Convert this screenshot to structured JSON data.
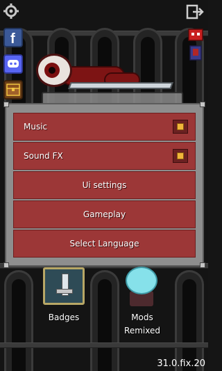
{
  "menu": {
    "items": [
      {
        "label": "Music",
        "type": "toggle",
        "checked": true
      },
      {
        "label": "Sound FX",
        "type": "toggle",
        "checked": true
      },
      {
        "label": "Ui settings",
        "type": "button"
      },
      {
        "label": "Gameplay",
        "type": "button"
      },
      {
        "label": "Select Language",
        "type": "button"
      }
    ]
  },
  "bottom": {
    "badges_label": "Badges",
    "mods_label": "Mods",
    "remixed_label": "Remixed"
  },
  "version": "31.0.fix.20",
  "icons": {
    "settings": "gear-icon",
    "exit": "exit-icon",
    "facebook": "facebook-icon",
    "discord": "discord-icon",
    "chest": "chest-icon",
    "mascot": "mascot-icon"
  },
  "colors": {
    "panel_row": "#9c3737",
    "check_fill": "#f0b63a",
    "frame": "#8e8e8e"
  }
}
